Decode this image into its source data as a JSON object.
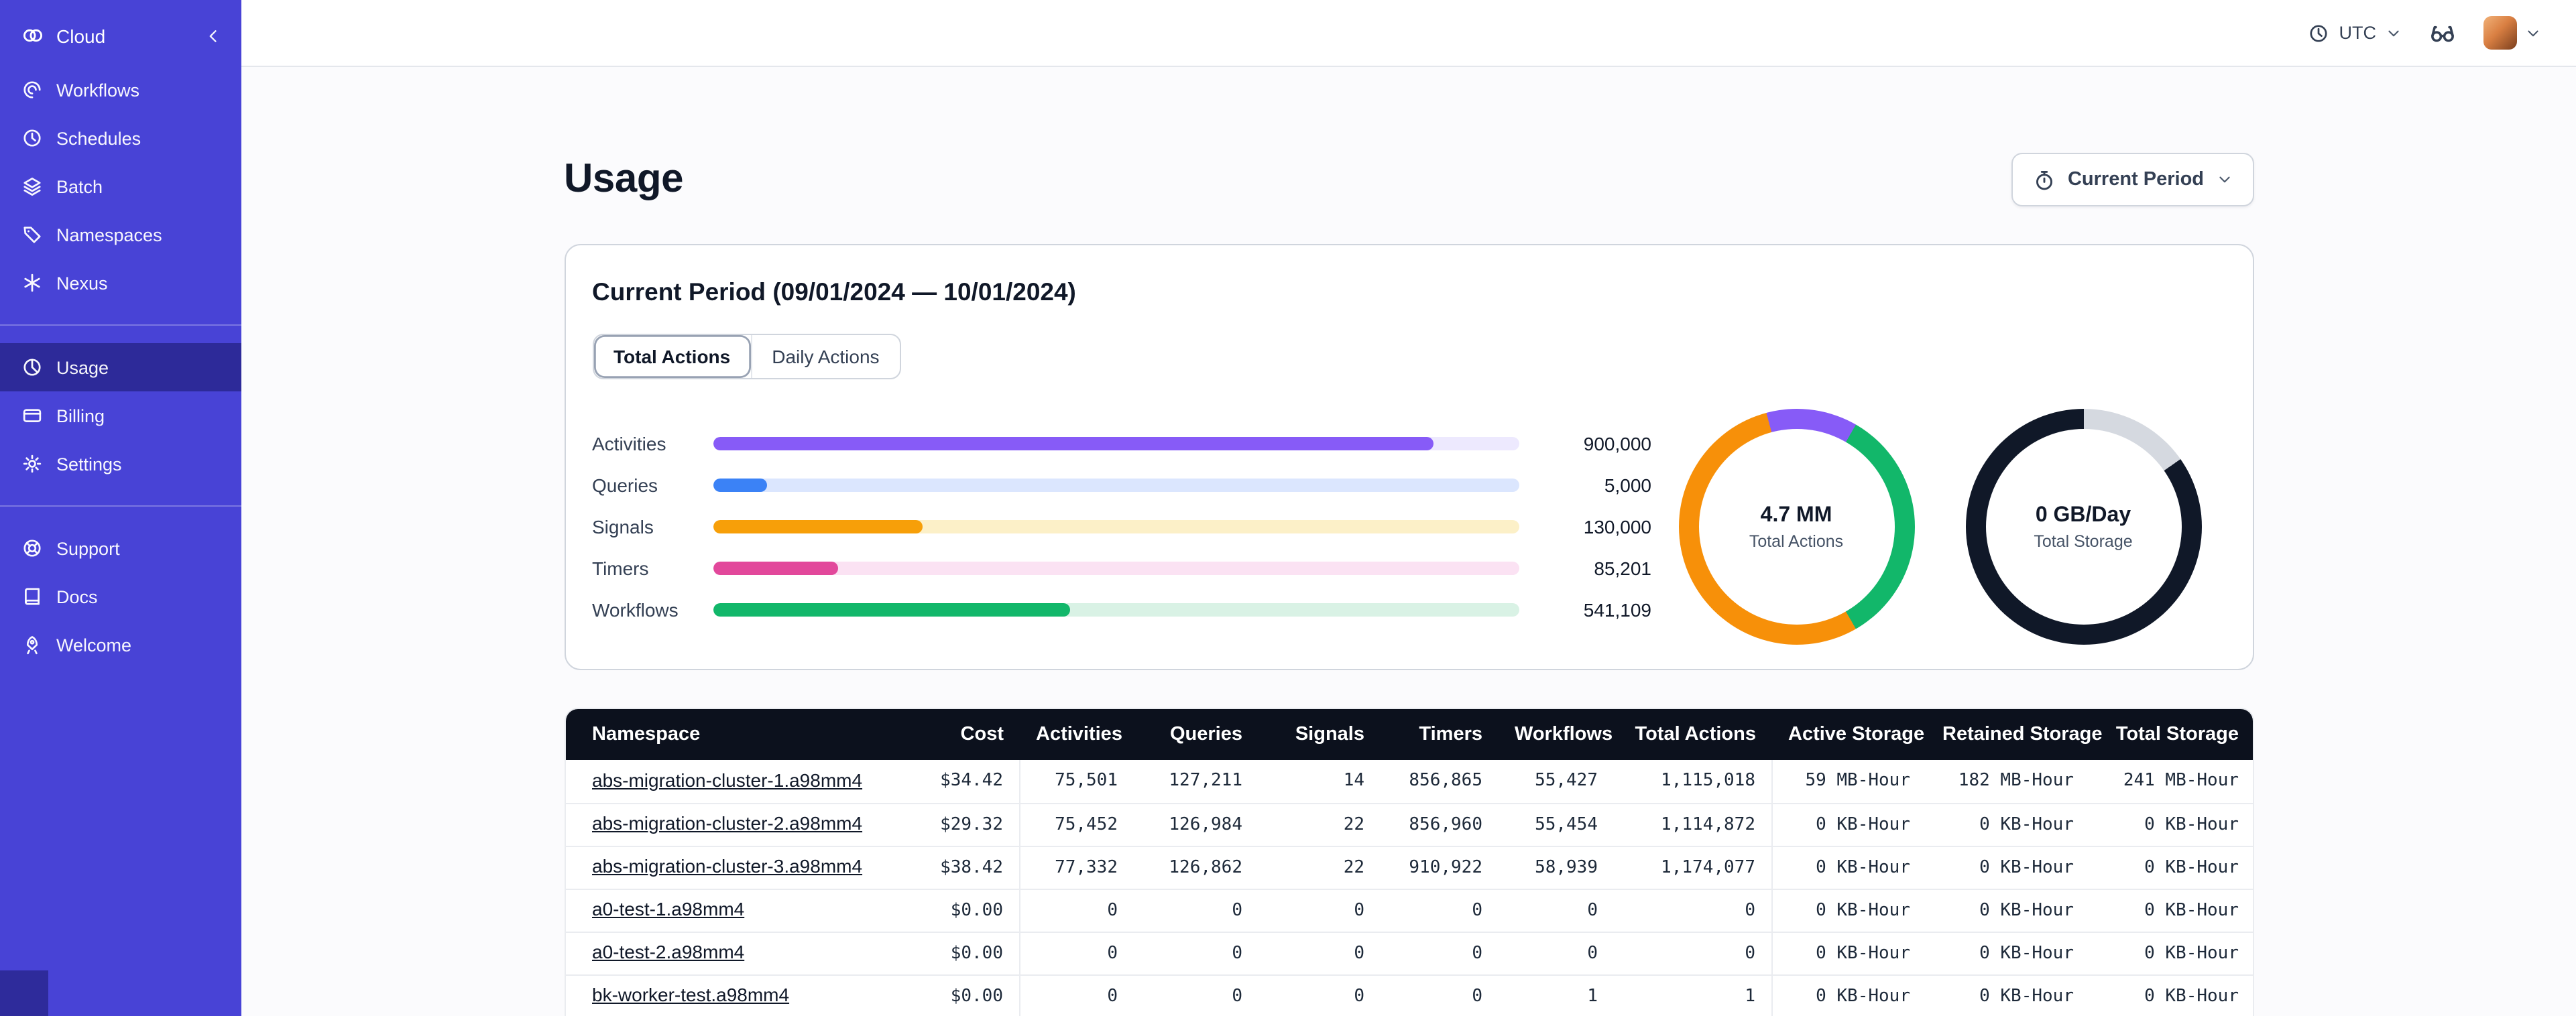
{
  "topbar": {
    "timezone_label": "UTC"
  },
  "sidebar": {
    "brand_label": "Cloud",
    "nav_top": [
      {
        "label": "Workflows",
        "icon": "workflows"
      },
      {
        "label": "Schedules",
        "icon": "schedules"
      },
      {
        "label": "Batch",
        "icon": "batch"
      },
      {
        "label": "Namespaces",
        "icon": "namespaces"
      },
      {
        "label": "Nexus",
        "icon": "nexus"
      }
    ],
    "nav_account": [
      {
        "label": "Usage",
        "icon": "usage",
        "active": true
      },
      {
        "label": "Billing",
        "icon": "billing"
      },
      {
        "label": "Settings",
        "icon": "settings"
      }
    ],
    "nav_links": [
      {
        "label": "Support",
        "icon": "support"
      },
      {
        "label": "Docs",
        "icon": "docs"
      },
      {
        "label": "Welcome",
        "icon": "welcome"
      }
    ]
  },
  "page": {
    "title": "Usage",
    "period_selector_label": "Current Period"
  },
  "usage_card": {
    "title": "Current Period (09/01/2024 — 10/01/2024)",
    "tabs": [
      {
        "label": "Total Actions",
        "active": true
      },
      {
        "label": "Daily Actions",
        "active": false
      }
    ],
    "chart_data": {
      "type": "bar",
      "bars": {
        "categories": [
          "Activities",
          "Queries",
          "Signals",
          "Timers",
          "Workflows"
        ],
        "values": [
          900000,
          5000,
          130000,
          85201,
          541109
        ],
        "value_labels": [
          "900,000",
          "5,000",
          "130,000",
          "85,201",
          "541,109"
        ],
        "percents": [
          89.4,
          6.7,
          26.1,
          15.5,
          44.3
        ],
        "colors": [
          "#875BF7",
          "#3B82F6",
          "#F79F09",
          "#E2489B",
          "#12B76A"
        ],
        "track_colors": [
          "#EDE9FE",
          "#DBE6FE",
          "#FCF0C8",
          "#FBE2F3",
          "#D9F2E5"
        ]
      },
      "donuts": [
        {
          "value": "4.7 MM",
          "label": "Total Actions",
          "from_deg": -15,
          "segments": [
            {
              "name": "purple",
              "color": "#875BF7",
              "deg": 45
            },
            {
              "name": "green",
              "color": "#12B76A",
              "deg": 120
            },
            {
              "name": "orange",
              "color": "#F79009",
              "deg": 195
            }
          ]
        },
        {
          "value": "0 GB/Day",
          "label": "Total Storage",
          "from_deg": 0,
          "segments": [
            {
              "name": "gray",
              "color": "#D5D9E0",
              "deg": 55
            },
            {
              "name": "dark",
              "color": "#101828",
              "deg": 305
            }
          ]
        }
      ]
    }
  },
  "table": {
    "columns": [
      "Namespace",
      "Cost",
      "Activities",
      "Queries",
      "Signals",
      "Timers",
      "Workflows",
      "Total Actions",
      "Active Storage",
      "Retained Storage",
      "Total Storage"
    ],
    "rows": [
      [
        "abs-migration-cluster-1.a98mm4",
        "$34.42",
        "75,501",
        "127,211",
        "14",
        "856,865",
        "55,427",
        "1,115,018",
        "59 MB-Hour",
        "182 MB-Hour",
        "241 MB-Hour"
      ],
      [
        "abs-migration-cluster-2.a98mm4",
        "$29.32",
        "75,452",
        "126,984",
        "22",
        "856,960",
        "55,454",
        "1,114,872",
        "0 KB-Hour",
        "0 KB-Hour",
        "0 KB-Hour"
      ],
      [
        "abs-migration-cluster-3.a98mm4",
        "$38.42",
        "77,332",
        "126,862",
        "22",
        "910,922",
        "58,939",
        "1,174,077",
        "0 KB-Hour",
        "0 KB-Hour",
        "0 KB-Hour"
      ],
      [
        "a0-test-1.a98mm4",
        "$0.00",
        "0",
        "0",
        "0",
        "0",
        "0",
        "0",
        "0 KB-Hour",
        "0 KB-Hour",
        "0 KB-Hour"
      ],
      [
        "a0-test-2.a98mm4",
        "$0.00",
        "0",
        "0",
        "0",
        "0",
        "0",
        "0",
        "0 KB-Hour",
        "0 KB-Hour",
        "0 KB-Hour"
      ],
      [
        "bk-worker-test.a98mm4",
        "$0.00",
        "0",
        "0",
        "0",
        "0",
        "1",
        "1",
        "0 KB-Hour",
        "0 KB-Hour",
        "0 KB-Hour"
      ]
    ]
  }
}
